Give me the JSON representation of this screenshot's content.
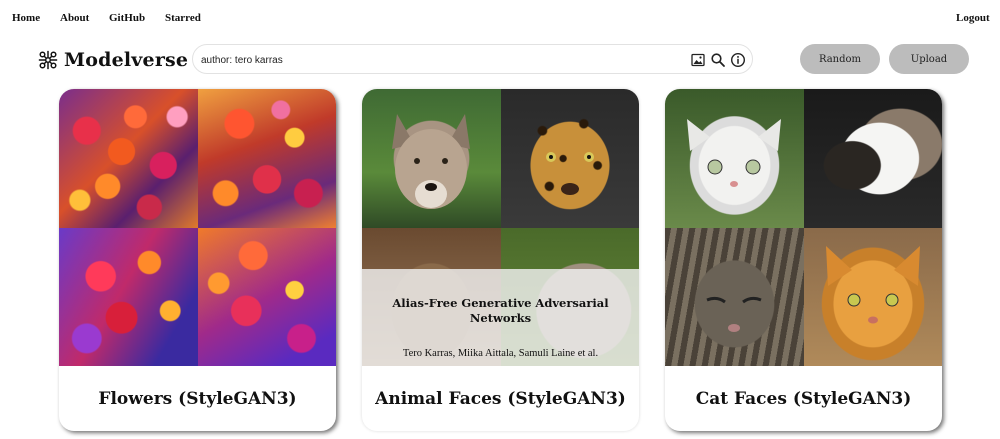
{
  "nav": {
    "home": "Home",
    "about": "About",
    "github": "GitHub",
    "starred": "Starred",
    "logout": "Logout"
  },
  "brand": {
    "name": "Modelverse",
    "icon": "model-grid-icon"
  },
  "search": {
    "value": "author: tero karras",
    "icons": [
      "image-search-icon",
      "search-icon",
      "info-icon"
    ]
  },
  "actions": {
    "random": "Random",
    "upload": "Upload"
  },
  "cards": [
    {
      "title": "Flowers (StyleGAN3)"
    },
    {
      "title": "Animal Faces (StyleGAN3)",
      "overlay_title": "Alias-Free Generative Adversarial Networks",
      "overlay_authors": "Tero Karras, Miika Aittala, Samuli Laine et al."
    },
    {
      "title": "Cat Faces (StyleGAN3)"
    }
  ],
  "colors": {
    "button_bg": "#bcbcbc",
    "overlay_bg": "rgba(240,240,240,0.82)"
  }
}
